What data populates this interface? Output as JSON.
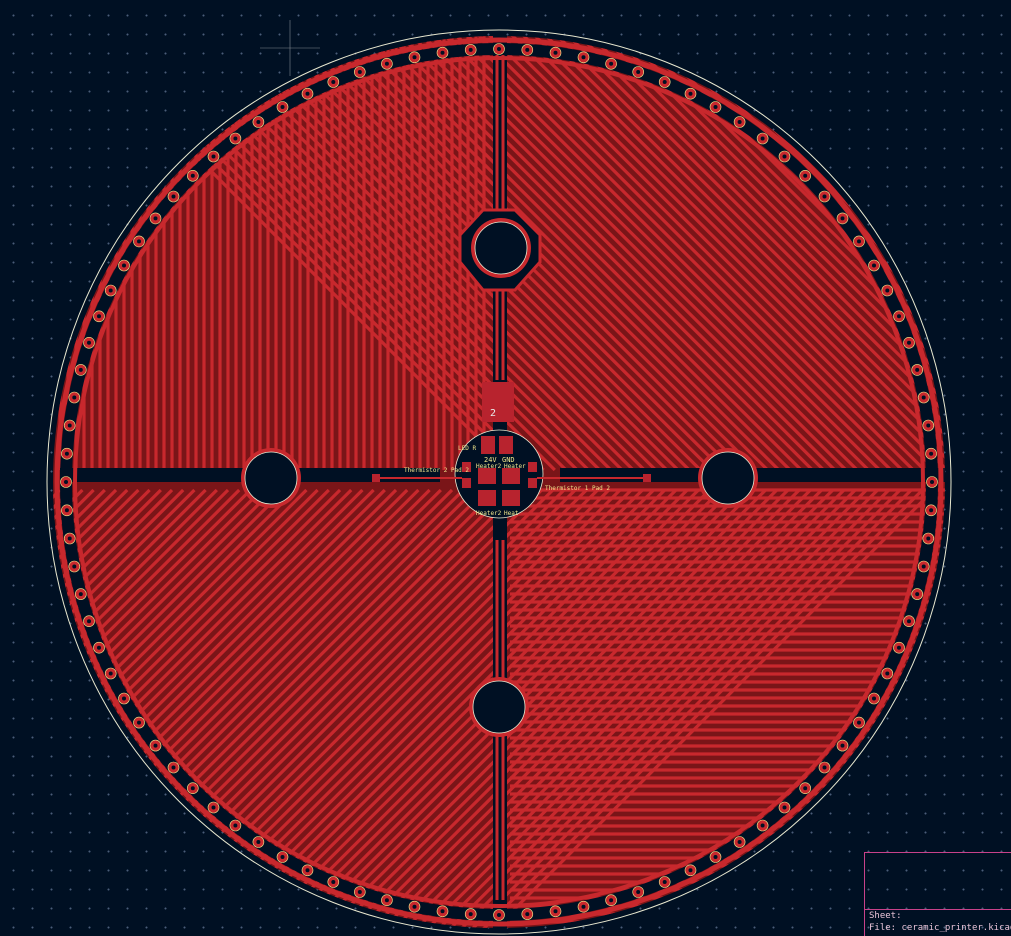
{
  "colors": {
    "background": "#001023",
    "grid": "#4a5d78",
    "copper": "#c8282d",
    "copper_dark": "#7a1518",
    "silkscreen": "#f0e68c",
    "edge_cuts": "#e8e8d0",
    "pad": "#b8232e",
    "drawing_sheet": "#c8418a"
  },
  "board": {
    "labels": {
      "v24": "24V",
      "gnd": "GND",
      "thermistor2": "Thermistor 2 Pad 2",
      "thermistor1": "Thermistor 1 Pad 2",
      "heater2_a": "Heater2",
      "heater_b": "Heater",
      "heater2_c": "Heater2",
      "heater_d": "Heat",
      "led_r": "LED R",
      "slot_num": "2"
    },
    "mounting_holes": [
      "top",
      "left",
      "right",
      "bottom"
    ]
  },
  "title_block": {
    "sheet_label": "Sheet:",
    "file_label": "File: ceramic_printer.kicad_pcb"
  }
}
